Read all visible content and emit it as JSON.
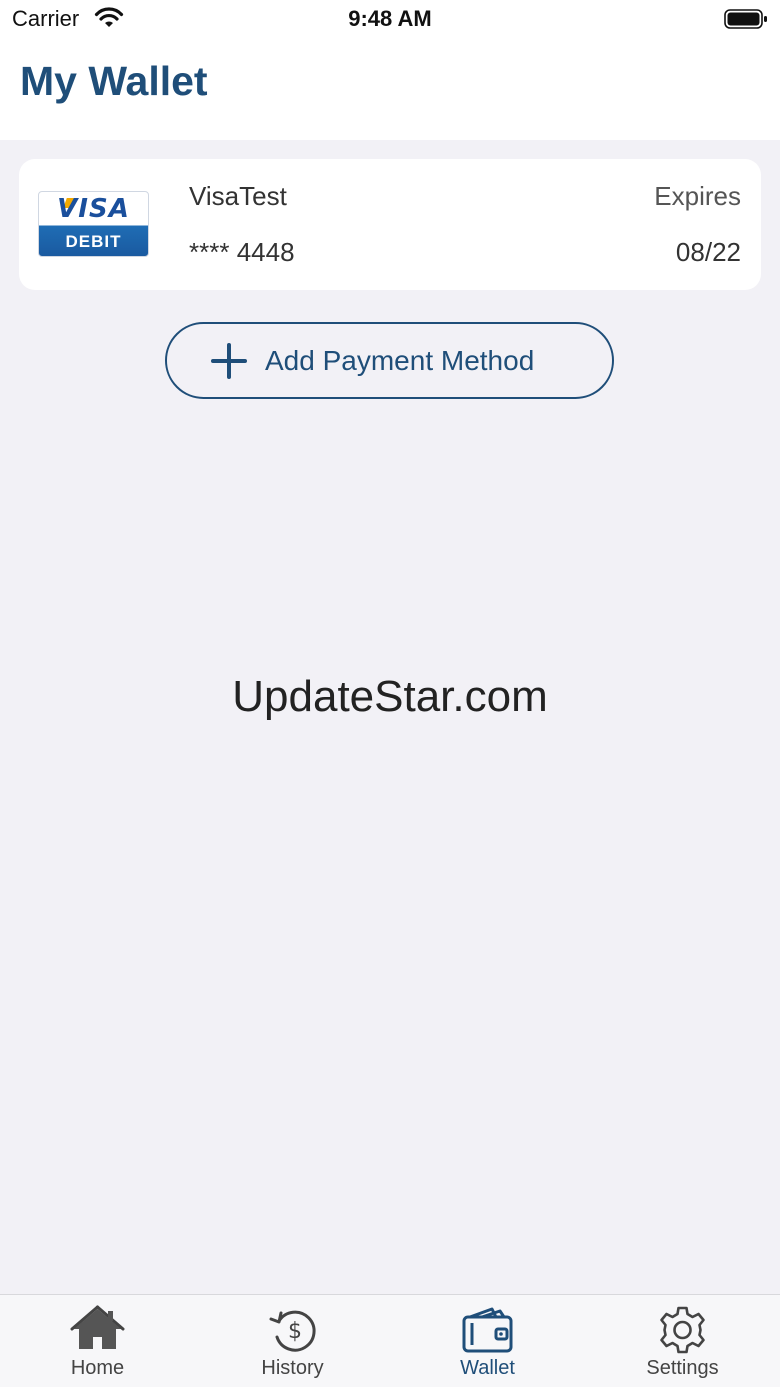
{
  "status_bar": {
    "carrier": "Carrier",
    "time": "9:48 AM"
  },
  "header": {
    "title": "My Wallet"
  },
  "card": {
    "logo_brand": "VISA",
    "logo_type": "DEBIT",
    "name": "VisaTest",
    "masked_number": "**** 4448",
    "expires_label": "Expires",
    "expiry": "08/22"
  },
  "add_payment": {
    "label": "Add Payment Method"
  },
  "watermark": "UpdateStar.com",
  "tabs": [
    {
      "label": "Home",
      "icon": "house-icon",
      "active": false
    },
    {
      "label": "History",
      "icon": "history-dollar-icon",
      "active": false
    },
    {
      "label": "Wallet",
      "icon": "wallet-icon",
      "active": true
    },
    {
      "label": "Settings",
      "icon": "gear-icon",
      "active": false
    }
  ],
  "colors": {
    "brand": "#1f4e79",
    "background": "#f2f1f6",
    "card_bg": "#ffffff"
  }
}
